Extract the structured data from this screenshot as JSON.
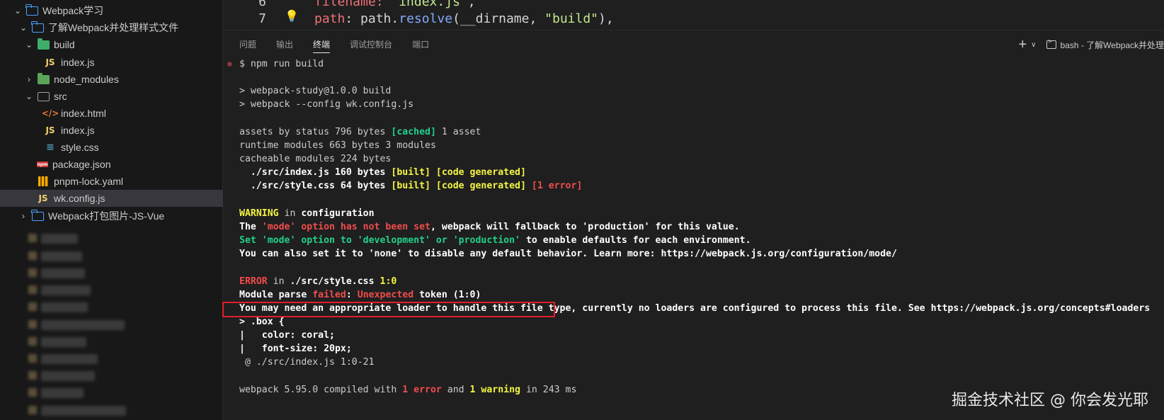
{
  "explorer": {
    "items": [
      {
        "label": "Webpack学习",
        "type": "folder-open",
        "chev": "⌄"
      },
      {
        "label": "了解Webpack并处理样式文件",
        "type": "folder-open",
        "chev": "⌄"
      },
      {
        "label": "build",
        "type": "folder-build",
        "chev": "⌄"
      },
      {
        "label": "index.js",
        "type": "js",
        "icon": "JS"
      },
      {
        "label": "node_modules",
        "type": "folder-nm",
        "chev": "›"
      },
      {
        "label": "src",
        "type": "folder-src",
        "chev": "⌄"
      },
      {
        "label": "index.html",
        "type": "html",
        "icon": "</>"
      },
      {
        "label": "index.js",
        "type": "js",
        "icon": "JS"
      },
      {
        "label": "style.css",
        "type": "css",
        "icon": "≡"
      },
      {
        "label": "package.json",
        "type": "npm",
        "icon": "npm"
      },
      {
        "label": "pnpm-lock.yaml",
        "type": "yaml"
      },
      {
        "label": "wk.config.js",
        "type": "js",
        "icon": "JS",
        "selected": true
      },
      {
        "label": "Webpack打包图片-JS-Vue",
        "type": "folder-open",
        "chev": "›"
      }
    ]
  },
  "editor": {
    "lines": [
      {
        "num": "6",
        "pre": "filename: ",
        "str": "\"index.js\"",
        "post": ","
      },
      {
        "num": "7",
        "key": "path",
        "colon": ": ",
        "obj": "path.",
        "fn": "resolve",
        "args": "(__dirname, ",
        "str": "\"build\"",
        "post": "),"
      }
    ]
  },
  "panel": {
    "tabs": [
      "问题",
      "输出",
      "终端",
      "调试控制台",
      "端口"
    ],
    "active_tab": "终端",
    "new_terminal": "+",
    "dropdown": "∨",
    "terminal_name": "bash - 了解Webpack并处理"
  },
  "terminal": {
    "prompt": "$ npm run build",
    "l1": "> webpack-study@1.0.0 build",
    "l2": "> webpack --config wk.config.js",
    "assets_pre": "assets by status 796 bytes ",
    "assets_tag": "[cached]",
    "assets_post": " 1 asset",
    "runtime": "runtime modules 663 bytes 3 modules",
    "cacheable": "cacheable modules 224 bytes",
    "mod1_pre": "  ./src/index.js 160 bytes ",
    "built": "[built]",
    "codegen": "[code generated]",
    "mod2_pre": "  ./src/style.css 64 bytes ",
    "one_error": "[1 error]",
    "warn_word": "WARNING",
    "warn_in": " in ",
    "warn_loc": "configuration",
    "w1a": "The ",
    "w1b": "'mode' option has not been set",
    "w1c": ", webpack will fallback to 'production' for this value.",
    "w2a": "Set ",
    "w2b": "'mode' option to 'development' or 'production'",
    "w2c": " to enable defaults for each environment.",
    "w3": "You can also set it to 'none' to disable any default behavior. Learn more: https://webpack.js.org/configuration/mode/",
    "err_word": "ERROR",
    "err_in": " in ",
    "err_loc": "./src/style.css",
    "err_pos": " 1:0",
    "e1a": "Module parse ",
    "e1b": "failed",
    "e1c": ": ",
    "e1d": "Unexpected",
    "e1e": " token (1:0)",
    "e2": "You may need an appropriate loader to handle this file type, currently no loaders are configured to process this file. See https://webpack.js.org/concepts#loaders",
    "c1": "> .box {",
    "c2": "|   color: coral;",
    "c3": "|   font-size: 20px;",
    "at": " @ ./src/index.js 1:0-21",
    "f_a": "webpack 5.95.0 compiled with ",
    "f_b": "1 error",
    "f_c": " and ",
    "f_d": "1 warning",
    "f_e": " in 243 ms"
  },
  "watermark": "掘金技术社区 @ 你会发光耶"
}
